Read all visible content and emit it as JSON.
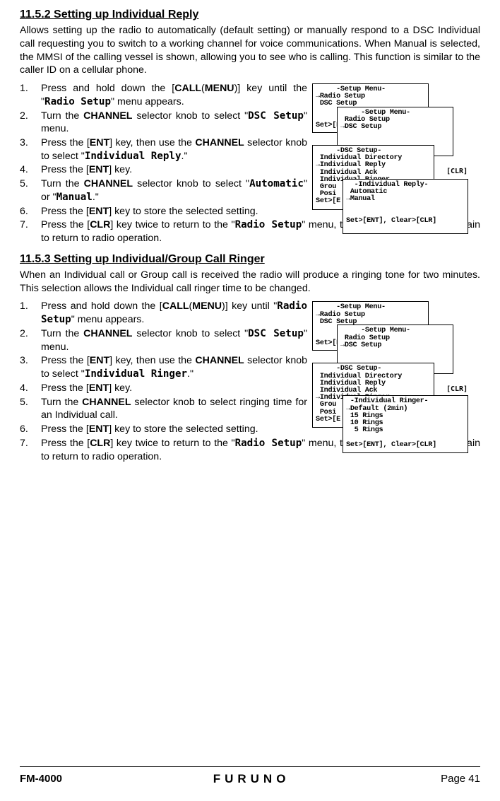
{
  "section1": {
    "heading": "11.5.2  Setting up Individual Reply",
    "intro": "Allows setting up the radio to automatically (default setting) or manually respond to a DSC Individual call requesting you to switch to a working channel for voice communications. When Manual is selected, the MMSI of the calling vessel is shown, allowing you to see who is calling. This function is similar to the caller ID on a cellular phone.",
    "steps": {
      "s1_a": "Press and hold down the [",
      "s1_b": "CALL",
      "s1_c": "(",
      "s1_d": "MENU",
      "s1_e": ")] key until the \"",
      "s1_f": "Radio Setup",
      "s1_g": "\" menu appears.",
      "s2_a": "Turn the ",
      "s2_b": "CHANNEL",
      "s2_c": " selector knob to select \"",
      "s2_d": "DSC Setup",
      "s2_e": "\" menu.",
      "s3_a": "Press the [",
      "s3_b": "ENT",
      "s3_c": "] key, then use the ",
      "s3_d": "CHANNEL",
      "s3_e": " selector knob to select \"",
      "s3_f": "Individual Reply",
      "s3_g": ".\"",
      "s4_a": "Press the [",
      "s4_b": "ENT",
      "s4_c": "] key.",
      "s5_a": "Turn the ",
      "s5_b": "CHANNEL",
      "s5_c": " selector knob to select \"",
      "s5_d": "Automatic",
      "s5_e": "\" or \"",
      "s5_f": "Manual",
      "s5_g": ".\"",
      "s6_a": "Press the [",
      "s6_b": "ENT",
      "s6_c": "] key to store the selected setting.",
      "s7_a": "Press the [",
      "s7_b": "CLR",
      "s7_c": "] key twice to return to the \"",
      "s7_d": "Radio Setup",
      "s7_e": "\" menu, then press the [",
      "s7_f": "CLR",
      "s7_g": "] key again to return to radio operation."
    },
    "lcd": {
      "a": "     -Setup Menu-\n→Radio Setup\n DSC Setup\n\n\nSet>[E",
      "b": "     -Setup Menu-\n Radio Setup\n→DSC Setup\n\n\n",
      "c": "     -DSC Setup-\n Individual Directory\n→Individual Reply\n Individual Ack\n Individual Ringer\n Grou\n Posi\nSet>[E",
      "c_tail": "[CLR]",
      "d": "  -Individual Reply-\n Automatic\n→Manual\n\n\nSet>[ENT], Clear>[CLR]"
    }
  },
  "section2": {
    "heading": "11.5.3  Setting up Individual/Group Call Ringer",
    "intro": "When an Individual call or Group call is received the radio will produce a ringing tone for two minutes. This selection allows the Individual call ringer time to be changed.",
    "steps": {
      "s1_a": "Press and hold down the [",
      "s1_b": "CALL",
      "s1_c": "(",
      "s1_d": "MENU",
      "s1_e": ")] key until \"",
      "s1_f": "Radio Setup",
      "s1_g": "\" menu appears.",
      "s2_a": "Turn the ",
      "s2_b": "CHANNEL",
      "s2_c": " selector knob to select \"",
      "s2_d": "DSC Setup",
      "s2_e": "\" menu.",
      "s3_a": "Press the [",
      "s3_b": "ENT",
      "s3_c": "] key, then use the ",
      "s3_d": "CHANNEL",
      "s3_e": " selector knob to select \"",
      "s3_f": "Individual Ringer",
      "s3_g": ".\"",
      "s4_a": "Press the [",
      "s4_b": "ENT",
      "s4_c": "] key.",
      "s5_a": "Turn the ",
      "s5_b": "CHANNEL",
      "s5_c": " selector knob to select ringing time for an Individual call.",
      "s6_a": "Press the [",
      "s6_b": "ENT",
      "s6_c": "] key to store the selected setting.",
      "s7_a": "Press the [",
      "s7_b": "CLR",
      "s7_c": "] key twice to return to the \"",
      "s7_d": "Radio Setup",
      "s7_e": "\" menu, then press the [",
      "s7_f": "CLR",
      "s7_g": "] key again to return to radio operation."
    },
    "lcd": {
      "a": "     -Setup Menu-\n→Radio Setup\n DSC Setup\n\n\nSet>[E",
      "b": "     -Setup Menu-\n Radio Setup\n→DSC Setup\n\n\n",
      "c": "     -DSC Setup-\n Individual Directory\n Individual Reply\n Individual Ack\n→Individual Ringer\n Grou\n Posi\nSet>[E",
      "c_tail": "[CLR]",
      "d": " -Individual Ringer-\n→Default (2min)\n 15 Rings\n 10 Rings\n  5 Rings\n\nSet>[ENT], Clear>[CLR]"
    }
  },
  "footer": {
    "model": "FM-4000",
    "brand": "FURUNO",
    "page": "Page 41"
  }
}
